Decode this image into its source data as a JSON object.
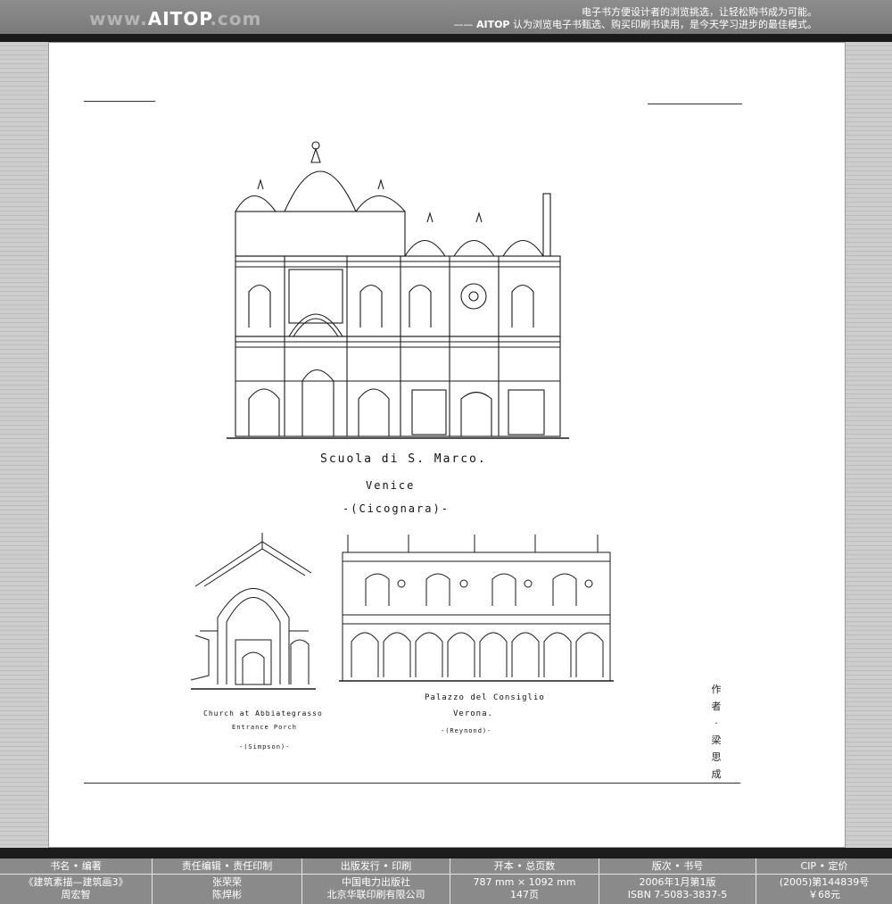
{
  "header": {
    "logo_prefix": "www.",
    "logo_brand": "AITOP",
    "logo_suffix": ".com",
    "slogan_line1": "电子书方便设计者的浏览挑选，让轻松购书成为可能。",
    "slogan_line2_prefix": "—— ",
    "slogan_line2_brand": "AITOP",
    "slogan_line2_rest": " 认为浏览电子书甄选、购买印刷书读用，是今天学习进步的最佳模式。"
  },
  "page": {
    "main_caption": {
      "line1": "Scuola di S. Marco.",
      "line2": "Venice",
      "line3": "-(Cicognara)-"
    },
    "left_caption": {
      "line1": "Church at Abbiategrasso",
      "line2": "Entrance Porch",
      "line3": "-(Simpson)-"
    },
    "right_caption": {
      "line1": "Palazzo del Consiglio",
      "line2": "Verona.",
      "line3": "-(Reynond)-"
    },
    "author": [
      "作",
      "者",
      "·",
      "梁",
      "思",
      "成"
    ]
  },
  "footer": {
    "columns": [
      {
        "header": "书名 • 编著",
        "line1": "《建筑素描—建筑画3》",
        "line2": "周宏智"
      },
      {
        "header": "责任编辑 • 责任印制",
        "line1": "张荣荣",
        "line2": "陈焊彬"
      },
      {
        "header": "出版发行 • 印刷",
        "line1": "中国电力出版社",
        "line2": "北京华联印刷有限公司"
      },
      {
        "header": "开本 • 总页数",
        "line1": "787 mm × 1092 mm",
        "line2": "147页"
      },
      {
        "header": "版次 • 书号",
        "line1": "2006年1月第1版",
        "line2": "ISBN 7-5083-3837-5"
      },
      {
        "header": "CIP • 定价",
        "line1": "(2005)第144839号",
        "line2": "￥68元"
      }
    ]
  },
  "colors": {
    "header_bg": "#808080",
    "band": "#1a1a1a",
    "footer_bg": "#8a8a8a",
    "ink": "#111111"
  }
}
